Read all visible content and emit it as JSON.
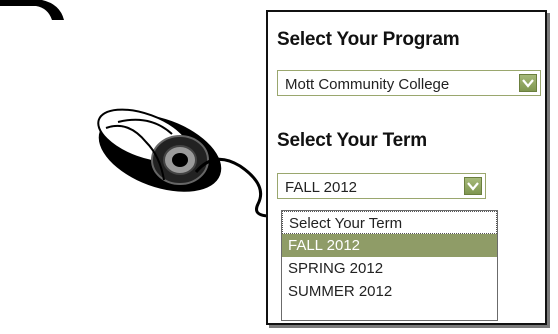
{
  "program": {
    "heading": "Select Your Program",
    "selected": "Mott Community College"
  },
  "term": {
    "heading": "Select Your Term",
    "selected": "FALL 2012",
    "options": [
      "Select Your Term",
      "FALL 2012",
      "SPRING 2012",
      "SUMMER 2012"
    ],
    "highlighted_index": 1
  },
  "colors": {
    "accent": "#8f9c67",
    "dropdown_button": "#8ea55e"
  },
  "icons": [
    "mouse-icon",
    "chevron-down-icon"
  ]
}
